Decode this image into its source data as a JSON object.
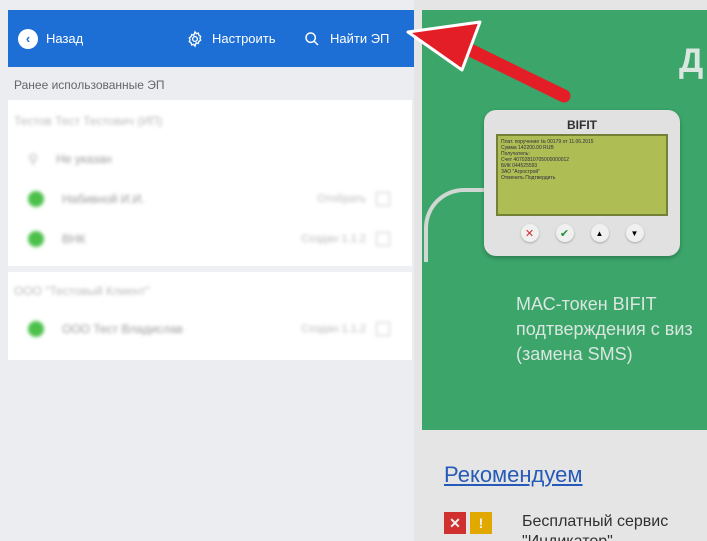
{
  "header": {
    "back_label": "Назад",
    "configure_label": "Настроить",
    "find_label": "Найти ЭП",
    "icons": {
      "back": "back-arrow-icon",
      "configure": "gear-icon",
      "find": "search-icon"
    },
    "accent_color": "#1d6fd6"
  },
  "section": {
    "label": "Ранее использованные ЭП"
  },
  "list": {
    "groups": [
      {
        "title": "Тестов Тест Тестович (ИП)",
        "rows": [
          {
            "name": "Не указан",
            "meta": "",
            "type": "search"
          },
          {
            "name": "Набивной И.И.",
            "meta": "Отобрать"
          },
          {
            "name": "ВНК",
            "meta": "Создан 1.1.2"
          }
        ]
      },
      {
        "title": "ООО \"Тестовый Клиент\"",
        "rows": [
          {
            "name": "ООО Тест Владислав",
            "meta": "Создан 1.1.2"
          }
        ]
      }
    ]
  },
  "background": {
    "title_partial": "Д",
    "device": {
      "brand": "BIFIT",
      "screen_lines": [
        "Плат. поручение № 00179 от 11.06.2015",
        "Сумма 142200.00 RUB",
        "Получатель:",
        "Счет 40702810705000000012",
        "БИК 044525593",
        "ЗАО \"Агрострой\"",
        "Отменить    Подтвердить"
      ]
    },
    "description": "МАС-токен BIFIT подтверждения с виз (замена SMS)",
    "recommend": "Рекомендуем",
    "service": "Бесплатный сервис \"Индикатор\"",
    "green_color": "#3fb071"
  }
}
